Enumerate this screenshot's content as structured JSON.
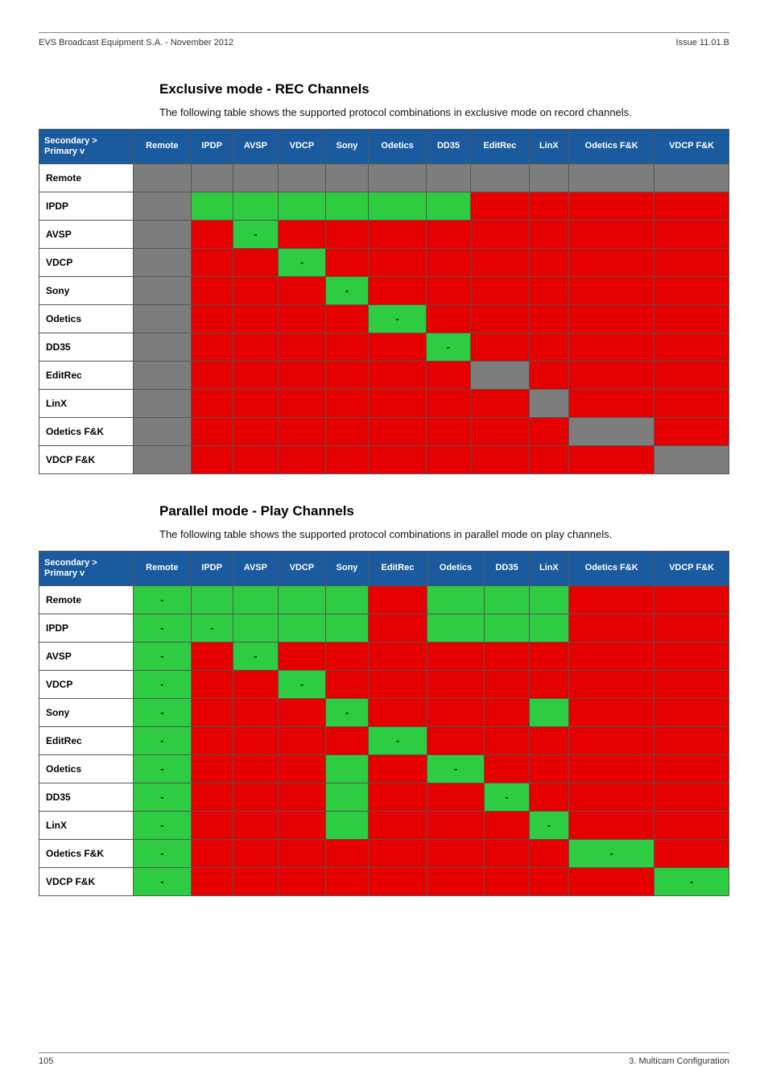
{
  "header": {
    "left": "EVS Broadcast Equipment S.A.  - November 2012",
    "right": "Issue 11.01.B"
  },
  "sectionA": {
    "title": "Exclusive mode - REC Channels",
    "desc": "The following table shows the supported protocol combinations in exclusive mode on record channels."
  },
  "tableA": {
    "corner_top": "Secondary >",
    "corner_bottom": "Primary v",
    "cols": [
      "Remote",
      "IPDP",
      "AVSP",
      "VDCP",
      "Sony",
      "Odetics",
      "DD35",
      "EditRec",
      "LinX",
      "Odetics F&K",
      "VDCP F&K"
    ],
    "rows": [
      {
        "name": "Remote",
        "cells": [
          "grey",
          "grey",
          "grey",
          "grey",
          "grey",
          "grey",
          "grey",
          "grey",
          "grey",
          "grey",
          "grey"
        ]
      },
      {
        "name": "IPDP",
        "cells": [
          "grey",
          "green",
          "green",
          "green",
          "green",
          "green",
          "green",
          "red",
          "red",
          "red",
          "red"
        ]
      },
      {
        "name": "AVSP",
        "cells": [
          "grey",
          "red",
          "green-",
          "red",
          "red",
          "red",
          "red",
          "red",
          "red",
          "red",
          "red"
        ]
      },
      {
        "name": "VDCP",
        "cells": [
          "grey",
          "red",
          "red",
          "green-",
          "red",
          "red",
          "red",
          "red",
          "red",
          "red",
          "red"
        ]
      },
      {
        "name": "Sony",
        "cells": [
          "grey",
          "red",
          "red",
          "red",
          "green-",
          "red",
          "red",
          "red",
          "red",
          "red",
          "red"
        ]
      },
      {
        "name": "Odetics",
        "cells": [
          "grey",
          "red",
          "red",
          "red",
          "red",
          "green-",
          "red",
          "red",
          "red",
          "red",
          "red"
        ]
      },
      {
        "name": "DD35",
        "cells": [
          "grey",
          "red",
          "red",
          "red",
          "red",
          "red",
          "green-",
          "red",
          "red",
          "red",
          "red"
        ]
      },
      {
        "name": "EditRec",
        "cells": [
          "grey",
          "red",
          "red",
          "red",
          "red",
          "red",
          "red",
          "grey",
          "red",
          "red",
          "red"
        ]
      },
      {
        "name": "LinX",
        "cells": [
          "grey",
          "red",
          "red",
          "red",
          "red",
          "red",
          "red",
          "red",
          "grey",
          "red",
          "red"
        ]
      },
      {
        "name": "Odetics F&K",
        "cells": [
          "grey",
          "red",
          "red",
          "red",
          "red",
          "red",
          "red",
          "red",
          "red",
          "grey",
          "red"
        ]
      },
      {
        "name": "VDCP F&K",
        "cells": [
          "grey",
          "red",
          "red",
          "red",
          "red",
          "red",
          "red",
          "red",
          "red",
          "red",
          "grey"
        ]
      }
    ]
  },
  "sectionB": {
    "title": "Parallel mode - Play Channels",
    "desc": "The following table shows the supported protocol combinations in parallel mode on play channels."
  },
  "tableB": {
    "corner_top": "Secondary >",
    "corner_bottom": "Primary v",
    "cols": [
      "Remote",
      "IPDP",
      "AVSP",
      "VDCP",
      "Sony",
      "EditRec",
      "Odetics",
      "DD35",
      "LinX",
      "Odetics F&K",
      "VDCP F&K"
    ],
    "rows": [
      {
        "name": "Remote",
        "cells": [
          "green-",
          "green",
          "green",
          "green",
          "green",
          "red",
          "green",
          "green",
          "green",
          "red",
          "red"
        ]
      },
      {
        "name": "IPDP",
        "cells": [
          "green-",
          "green-",
          "green",
          "green",
          "green",
          "red",
          "green",
          "green",
          "green",
          "red",
          "red"
        ]
      },
      {
        "name": "AVSP",
        "cells": [
          "green-",
          "red",
          "green-",
          "red",
          "red",
          "red",
          "red",
          "red",
          "red",
          "red",
          "red"
        ]
      },
      {
        "name": "VDCP",
        "cells": [
          "green-",
          "red",
          "red",
          "green-",
          "red",
          "red",
          "red",
          "red",
          "red",
          "red",
          "red"
        ]
      },
      {
        "name": "Sony",
        "cells": [
          "green-",
          "red",
          "red",
          "red",
          "green-",
          "red",
          "red",
          "red",
          "green",
          "red",
          "red"
        ]
      },
      {
        "name": "EditRec",
        "cells": [
          "green-",
          "red",
          "red",
          "red",
          "red",
          "green-",
          "red",
          "red",
          "red",
          "red",
          "red"
        ]
      },
      {
        "name": "Odetics",
        "cells": [
          "green-",
          "red",
          "red",
          "red",
          "green",
          "red",
          "green-",
          "red",
          "red",
          "red",
          "red"
        ]
      },
      {
        "name": "DD35",
        "cells": [
          "green-",
          "red",
          "red",
          "red",
          "green",
          "red",
          "red",
          "green-",
          "red",
          "red",
          "red"
        ]
      },
      {
        "name": "LinX",
        "cells": [
          "green-",
          "red",
          "red",
          "red",
          "green",
          "red",
          "red",
          "red",
          "green-",
          "red",
          "red"
        ]
      },
      {
        "name": "Odetics F&K",
        "cells": [
          "green-",
          "red",
          "red",
          "red",
          "red",
          "red",
          "red",
          "red",
          "red",
          "green-",
          "red"
        ]
      },
      {
        "name": "VDCP F&K",
        "cells": [
          "green-",
          "red",
          "red",
          "red",
          "red",
          "red",
          "red",
          "red",
          "red",
          "red",
          "green-"
        ]
      }
    ]
  },
  "footer": {
    "left": "105",
    "right": "3. Multicam Configuration"
  }
}
